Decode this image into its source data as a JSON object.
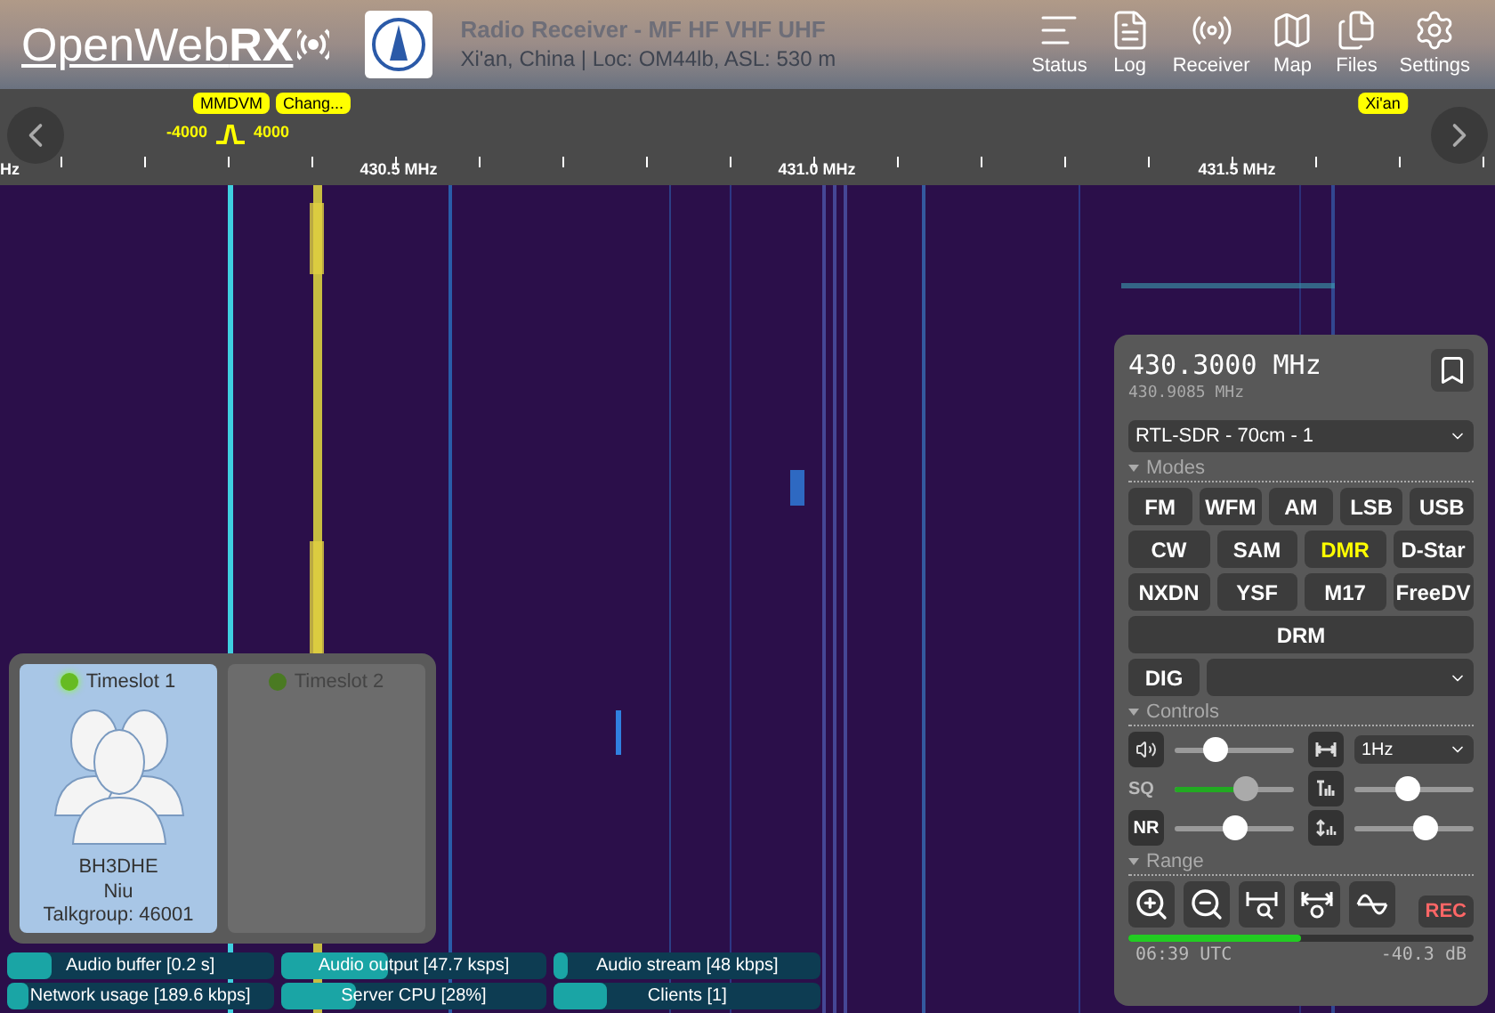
{
  "header": {
    "logo": "OpenWeb**RX**",
    "receiver_name": "Radio Receiver - MF HF VHF UHF",
    "location": "Xi'an, China | Loc: OM44lb, ASL: 530 m",
    "nav": [
      {
        "label": "Status",
        "kind": "status"
      },
      {
        "label": "Log",
        "kind": "log"
      },
      {
        "label": "Receiver",
        "kind": "receiver"
      },
      {
        "label": "Map",
        "kind": "map"
      },
      {
        "label": "Files",
        "kind": "files"
      },
      {
        "label": "Settings",
        "kind": "settings"
      }
    ]
  },
  "scale": {
    "edge_label": "Hz",
    "labels": [
      "430.5 MHz",
      "431.0 MHz",
      "431.5 MHz"
    ],
    "bookmarks": [
      "MMDVM",
      "Chang...",
      "Xi'an"
    ],
    "filter": {
      "low": "-4000",
      "high": "4000"
    }
  },
  "receiver_panel": {
    "frequency": "430.3000 MHz",
    "offset_frequency": "430.9085 MHz",
    "profile": "RTL-SDR - 70cm - 1",
    "modes_heading": "Modes",
    "mode_rows": [
      [
        {
          "label": "FM",
          "selected": false
        },
        {
          "label": "WFM",
          "selected": false
        },
        {
          "label": "AM",
          "selected": false
        },
        {
          "label": "LSB",
          "selected": false
        },
        {
          "label": "USB",
          "selected": false
        }
      ],
      [
        {
          "label": "CW",
          "selected": false
        },
        {
          "label": "SAM",
          "selected": false
        },
        {
          "label": "DMR",
          "selected": true
        },
        {
          "label": "D-Star",
          "selected": false
        }
      ],
      [
        {
          "label": "NXDN",
          "selected": false
        },
        {
          "label": "YSF",
          "selected": false
        },
        {
          "label": "M17",
          "selected": false
        },
        {
          "label": "FreeDV",
          "selected": false
        }
      ],
      [
        {
          "label": "DRM",
          "selected": false
        }
      ]
    ],
    "digital_button": "DIG",
    "controls_heading": "Controls",
    "volume": {
      "level": 0.35
    },
    "step": "1Hz",
    "squelch": {
      "label": "SQ",
      "level": 0.6
    },
    "waterfall_min": {
      "level": 0.45
    },
    "noise_reduction": {
      "label": "NR",
      "level": 0.5
    },
    "waterfall_max": {
      "level": 0.6
    },
    "range_heading": "Range",
    "record_button": "REC",
    "smeter": {
      "level": 0.5
    },
    "time": "06:39 UTC",
    "signal": "-40.3 dB"
  },
  "dmr_panel": {
    "timeslots": [
      {
        "label": "Timeslot 1",
        "active": true,
        "selected": true,
        "callsign": "BH3DHE",
        "name": "Niu",
        "talkgroup": "Talkgroup: 46001"
      },
      {
        "label": "Timeslot 2",
        "active": false,
        "selected": false
      }
    ]
  },
  "status_bars": [
    {
      "label": "Audio buffer [0.2 s]",
      "level": 0.17
    },
    {
      "label": "Audio output [47.7 ksps]",
      "level": 0.4
    },
    {
      "label": "Audio stream [48 kbps]",
      "level": 0.05
    },
    {
      "label": "Network usage [189.6 kbps]",
      "level": 0.08
    },
    {
      "label": "Server CPU [28%]",
      "level": 0.28
    },
    {
      "label": "Clients [1]",
      "level": 0.2
    }
  ]
}
